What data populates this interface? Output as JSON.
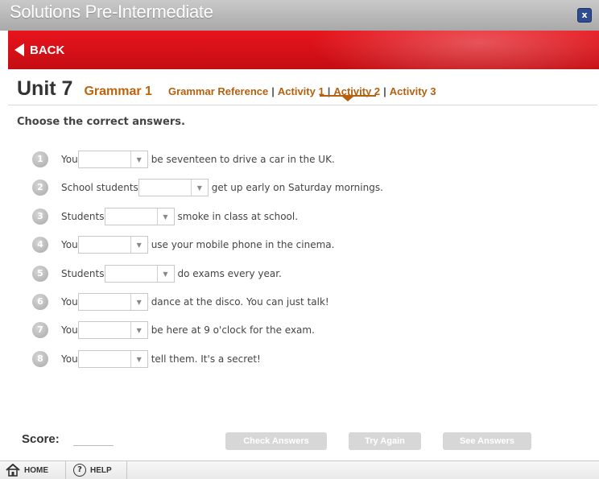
{
  "window": {
    "title": "Solutions Pre-Intermediate",
    "close_icon": "close-icon"
  },
  "nav": {
    "back_label": "BACK"
  },
  "header": {
    "unit": "Unit 7",
    "section": "Grammar 1",
    "links": [
      "Grammar Reference",
      "Activity 1",
      "Activity 2",
      "Activity 3"
    ],
    "separator": "|",
    "active_link": "Activity 1"
  },
  "instructions": "Choose the correct answers.",
  "questions": [
    {
      "number": "1",
      "before": "You",
      "after": "be seventeen to drive a car in the UK.",
      "value": ""
    },
    {
      "number": "2",
      "before": "School students",
      "after": "get up early on Saturday mornings.",
      "value": ""
    },
    {
      "number": "3",
      "before": "Students",
      "after": "smoke in class at school.",
      "value": ""
    },
    {
      "number": "4",
      "before": "You",
      "after": "use your mobile phone in the cinema.",
      "value": ""
    },
    {
      "number": "5",
      "before": "Students",
      "after": "do exams every year.",
      "value": ""
    },
    {
      "number": "6",
      "before": "You",
      "after": "dance at the disco. You can just talk!",
      "value": ""
    },
    {
      "number": "7",
      "before": "You",
      "after": "be here at 9 o'clock for the exam.",
      "value": ""
    },
    {
      "number": "8",
      "before": "You",
      "after": "tell them. It's a secret!",
      "value": ""
    }
  ],
  "score": {
    "label": "Score:",
    "value": ""
  },
  "buttons": {
    "check": "Check Answers",
    "try": "Try Again",
    "see": "See Answers"
  },
  "footer": {
    "home": "HOME",
    "help": "HELP",
    "help_icon_glyph": "?"
  },
  "colors": {
    "red_bar": "#e8141c",
    "accent": "#c0620c",
    "link": "#b5600e",
    "disabled_button": "#d7d7d7"
  }
}
